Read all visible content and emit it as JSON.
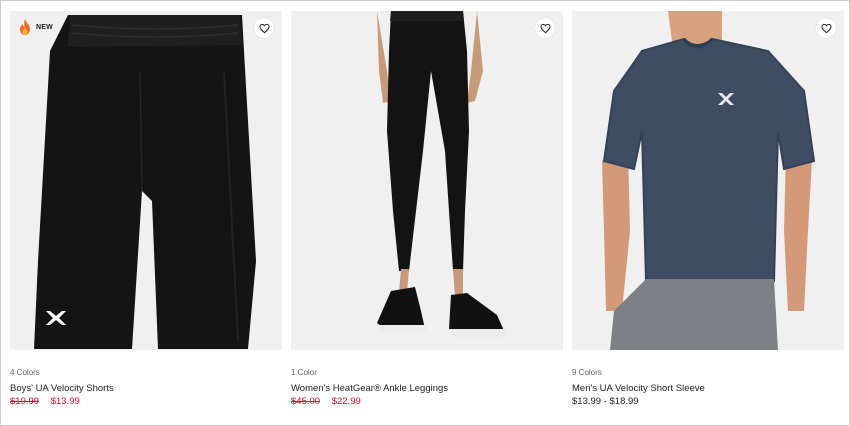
{
  "accent_color": "#d50e2a",
  "products": [
    {
      "badge": "NEW",
      "badge_icon": "flame-icon",
      "favorite_icon": "heart-outline-icon",
      "colors": "4 Colors",
      "name": "Boys' UA Velocity Shorts",
      "original_price": "$19.99",
      "sale_price": "$13.99"
    },
    {
      "favorite_icon": "heart-outline-icon",
      "colors": "1 Color",
      "name": "Women's HeatGear® Ankle Leggings",
      "original_price": "$45.00",
      "sale_price": "$22.99"
    },
    {
      "favorite_icon": "heart-outline-icon",
      "colors": "9 Colors",
      "name": "Men's UA Velocity Short Sleeve",
      "price_range": "$13.99 - $18.99"
    }
  ]
}
